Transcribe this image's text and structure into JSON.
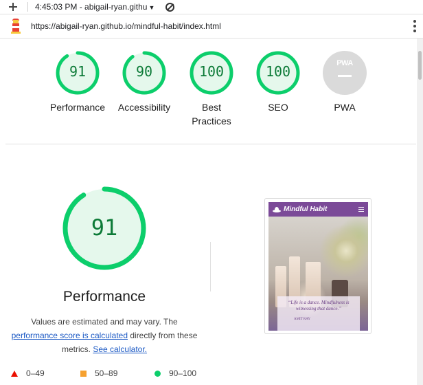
{
  "toolbar": {
    "time_title": "4:45:03 PM - abigail-ryan.githu",
    "caret": "▼"
  },
  "url_bar": {
    "url": "https://abigail-ryan.github.io/mindful-habit/index.html"
  },
  "gauges": [
    {
      "label": "Performance",
      "score": "91",
      "fraction": 0.91,
      "color": "#0cce6b"
    },
    {
      "label": "Accessibility",
      "score": "90",
      "fraction": 0.9,
      "color": "#0cce6b"
    },
    {
      "label": "Best Practices",
      "score": "100",
      "fraction": 1.0,
      "color": "#0cce6b"
    },
    {
      "label": "SEO",
      "score": "100",
      "fraction": 1.0,
      "color": "#0cce6b"
    },
    {
      "label": "PWA",
      "badge": "PWA",
      "color": "#dadada"
    }
  ],
  "performance": {
    "score": "91",
    "fraction": 0.91,
    "title": "Performance",
    "desc_pre": "Values are estimated and may vary. The ",
    "desc_link": "performance score is calculated",
    "desc_mid": " directly from these metrics. ",
    "desc_link2": "See calculator."
  },
  "thumbnail": {
    "brand": "Mindful Habit",
    "quote": "“Life is a dance. Mindfulness is witnessing that dance.”",
    "author": "AMIT RAY"
  },
  "legend": [
    {
      "range": "0–49",
      "color": "#eb0f00",
      "icon": "triangle-icon"
    },
    {
      "range": "50–89",
      "color": "#f6a130",
      "icon": "square-icon"
    },
    {
      "range": "90–100",
      "color": "#0cce6b",
      "icon": "circle-icon"
    }
  ],
  "colors": {
    "pass_green": "#0cce6b",
    "pass_text": "#0c7a37",
    "link_blue": "#1a58c4",
    "pwa_grey": "#dadada"
  }
}
